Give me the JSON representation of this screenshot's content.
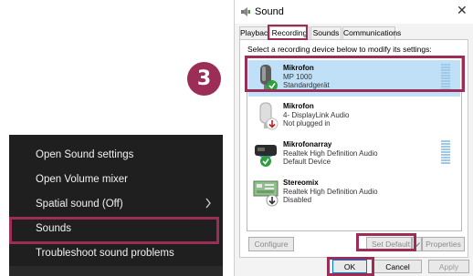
{
  "context_menu": {
    "items": [
      {
        "label": "Open Sound settings"
      },
      {
        "label": "Open Volume mixer"
      },
      {
        "label": "Spatial sound (Off)"
      },
      {
        "label": "Sounds"
      },
      {
        "label": "Troubleshoot sound problems"
      }
    ]
  },
  "step_badge": "3",
  "dialog": {
    "title": "Sound",
    "close_glyph": "✕",
    "tabs": [
      {
        "label": "Playback"
      },
      {
        "label": "Recording"
      },
      {
        "label": "Sounds"
      },
      {
        "label": "Communications"
      }
    ],
    "active_tab": "Recording",
    "instruction": "Select a recording device below to modify its settings:",
    "devices": [
      {
        "name": "Mikrofon",
        "desc": "MP 1000",
        "status": "Standardgerät",
        "badge": "check",
        "icon": "microphone-icon"
      },
      {
        "name": "Mikrofon",
        "desc": "4- DisplayLink Audio",
        "status": "Not plugged in",
        "badge": "down-arrow",
        "icon": "microphone-icon"
      },
      {
        "name": "Mikrofonarray",
        "desc": "Realtek High Definition Audio",
        "status": "Default Device",
        "badge": "check",
        "icon": "microphone-array-icon"
      },
      {
        "name": "Stereomix",
        "desc": "Realtek High Definition Audio",
        "status": "Disabled",
        "badge": "down-arrow",
        "icon": "circuit-board-icon"
      }
    ],
    "buttons": {
      "configure": "Configure",
      "set_default": "Set Default",
      "properties": "Properties",
      "ok": "OK",
      "cancel": "Cancel",
      "apply": "Apply"
    }
  },
  "colors": {
    "highlight": "#9b2d57",
    "selected_row": "#bfe0f7",
    "menu_bg": "#1f1f1f"
  }
}
